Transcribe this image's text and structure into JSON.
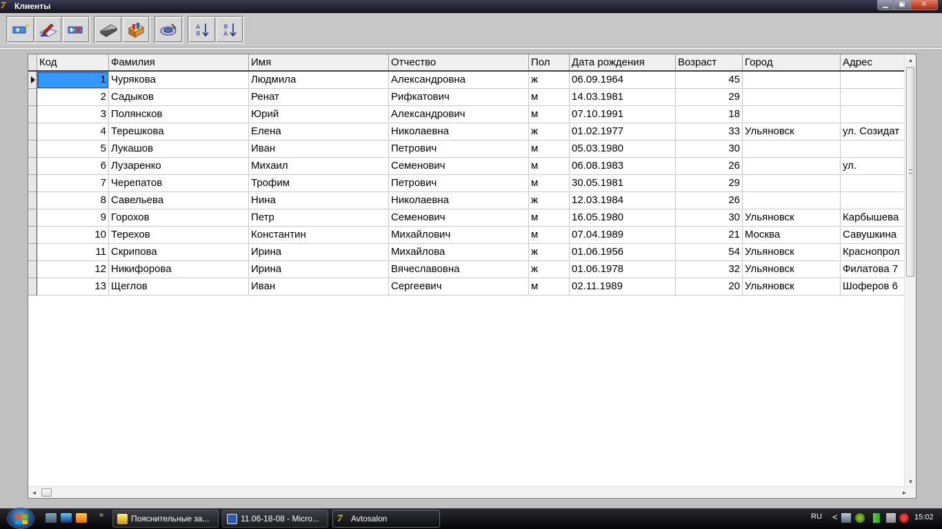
{
  "window": {
    "title": "Клиенты",
    "app_icon_text": "7"
  },
  "window_buttons": {
    "minimize": "▁",
    "restore": "▣",
    "close": "✕"
  },
  "toolbar": {
    "buttons": [
      {
        "name": "add-record-icon"
      },
      {
        "name": "edit-record-icon"
      },
      {
        "name": "delete-record-icon"
      },
      {
        "name": "print-icon"
      },
      {
        "name": "report-icon"
      },
      {
        "name": "search-icon"
      },
      {
        "name": "sort-ascending-icon",
        "label": "А↓"
      },
      {
        "name": "sort-descending-icon",
        "label": "Я↓"
      }
    ]
  },
  "grid": {
    "columns": [
      "Код",
      "Фамилия",
      "Имя",
      "Отчество",
      "Пол",
      "Дата рождения",
      "Возраст",
      "Город",
      "Адрес"
    ],
    "rows": [
      [
        "1",
        "Чурякова",
        "Людмила",
        "Александровна",
        "ж",
        "06.09.1964",
        "45",
        "",
        ""
      ],
      [
        "2",
        "Садыков",
        "Ренат",
        "Рифкатович",
        "м",
        "14.03.1981",
        "29",
        "",
        ""
      ],
      [
        "3",
        "Полянсков",
        "Юрий",
        "Александрович",
        "м",
        "07.10.1991",
        "18",
        "",
        ""
      ],
      [
        "4",
        "Терешкова",
        "Елена",
        "Николаевна",
        "ж",
        "01.02.1977",
        "33",
        "Ульяновск",
        "ул. Созидат"
      ],
      [
        "5",
        "Лукашов",
        "Иван",
        "Петрович",
        "м",
        "05.03.1980",
        "30",
        "",
        ""
      ],
      [
        "6",
        "Лузаренко",
        "Михаил",
        "Семенович",
        "м",
        "06.08.1983",
        "26",
        "",
        "ул."
      ],
      [
        "7",
        "Черепатов",
        "Трофим",
        "Петрович",
        "м",
        "30.05.1981",
        "29",
        "",
        ""
      ],
      [
        "8",
        "Савельева",
        "Нина",
        "Николаевна",
        "ж",
        "12.03.1984",
        "26",
        "",
        ""
      ],
      [
        "9",
        "Горохов",
        "Петр",
        "Семенович",
        "м",
        "16.05.1980",
        "30",
        "Ульяновск",
        "Карбышева"
      ],
      [
        "10",
        "Терехов",
        "Константин",
        "Михайлович",
        "м",
        "07.04.1989",
        "21",
        "Москва",
        "Савушкина"
      ],
      [
        "11",
        "Скрипова",
        "Ирина",
        "Михайлова",
        "ж",
        "01.06.1956",
        "54",
        "Ульяновск",
        "Краснопрол"
      ],
      [
        "12",
        "Никифорова",
        "Ирина",
        "Вячеславовна",
        "ж",
        "01.06.1978",
        "32",
        "Ульяновск",
        "Филатова 7"
      ],
      [
        "13",
        "Щеглов",
        "Иван",
        "Сергеевич",
        "м",
        "02.11.1989",
        "20",
        "Ульяновск",
        "Шоферов 6"
      ]
    ]
  },
  "scrollbars": {
    "up": "▲",
    "down": "▼",
    "left": "◄",
    "right": "►"
  },
  "taskbar": {
    "quicklaunch_more": "»",
    "tasks": [
      {
        "label": "Пояснительные за..."
      },
      {
        "label": "11.06-18-08 - Micro..."
      },
      {
        "label": "Avtosalon"
      }
    ],
    "tray": {
      "lang": "RU",
      "chevron": "<",
      "clock": "15:02"
    }
  },
  "colors": {
    "selection": "#3399ff",
    "titlebar": "#14141f",
    "taskbar": "#050508"
  }
}
